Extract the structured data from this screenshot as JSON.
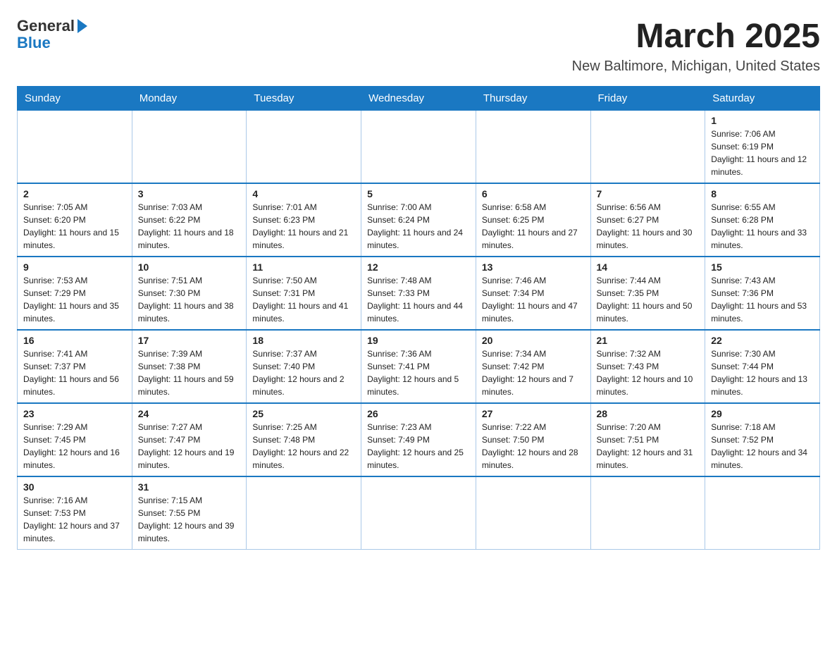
{
  "header": {
    "logo_general": "General",
    "logo_blue": "Blue",
    "title": "March 2025",
    "location": "New Baltimore, Michigan, United States"
  },
  "days_of_week": [
    "Sunday",
    "Monday",
    "Tuesday",
    "Wednesday",
    "Thursday",
    "Friday",
    "Saturday"
  ],
  "weeks": [
    [
      {
        "day": "",
        "sunrise": "",
        "sunset": "",
        "daylight": ""
      },
      {
        "day": "",
        "sunrise": "",
        "sunset": "",
        "daylight": ""
      },
      {
        "day": "",
        "sunrise": "",
        "sunset": "",
        "daylight": ""
      },
      {
        "day": "",
        "sunrise": "",
        "sunset": "",
        "daylight": ""
      },
      {
        "day": "",
        "sunrise": "",
        "sunset": "",
        "daylight": ""
      },
      {
        "day": "",
        "sunrise": "",
        "sunset": "",
        "daylight": ""
      },
      {
        "day": "1",
        "sunrise": "Sunrise: 7:06 AM",
        "sunset": "Sunset: 6:19 PM",
        "daylight": "Daylight: 11 hours and 12 minutes."
      }
    ],
    [
      {
        "day": "2",
        "sunrise": "Sunrise: 7:05 AM",
        "sunset": "Sunset: 6:20 PM",
        "daylight": "Daylight: 11 hours and 15 minutes."
      },
      {
        "day": "3",
        "sunrise": "Sunrise: 7:03 AM",
        "sunset": "Sunset: 6:22 PM",
        "daylight": "Daylight: 11 hours and 18 minutes."
      },
      {
        "day": "4",
        "sunrise": "Sunrise: 7:01 AM",
        "sunset": "Sunset: 6:23 PM",
        "daylight": "Daylight: 11 hours and 21 minutes."
      },
      {
        "day": "5",
        "sunrise": "Sunrise: 7:00 AM",
        "sunset": "Sunset: 6:24 PM",
        "daylight": "Daylight: 11 hours and 24 minutes."
      },
      {
        "day": "6",
        "sunrise": "Sunrise: 6:58 AM",
        "sunset": "Sunset: 6:25 PM",
        "daylight": "Daylight: 11 hours and 27 minutes."
      },
      {
        "day": "7",
        "sunrise": "Sunrise: 6:56 AM",
        "sunset": "Sunset: 6:27 PM",
        "daylight": "Daylight: 11 hours and 30 minutes."
      },
      {
        "day": "8",
        "sunrise": "Sunrise: 6:55 AM",
        "sunset": "Sunset: 6:28 PM",
        "daylight": "Daylight: 11 hours and 33 minutes."
      }
    ],
    [
      {
        "day": "9",
        "sunrise": "Sunrise: 7:53 AM",
        "sunset": "Sunset: 7:29 PM",
        "daylight": "Daylight: 11 hours and 35 minutes."
      },
      {
        "day": "10",
        "sunrise": "Sunrise: 7:51 AM",
        "sunset": "Sunset: 7:30 PM",
        "daylight": "Daylight: 11 hours and 38 minutes."
      },
      {
        "day": "11",
        "sunrise": "Sunrise: 7:50 AM",
        "sunset": "Sunset: 7:31 PM",
        "daylight": "Daylight: 11 hours and 41 minutes."
      },
      {
        "day": "12",
        "sunrise": "Sunrise: 7:48 AM",
        "sunset": "Sunset: 7:33 PM",
        "daylight": "Daylight: 11 hours and 44 minutes."
      },
      {
        "day": "13",
        "sunrise": "Sunrise: 7:46 AM",
        "sunset": "Sunset: 7:34 PM",
        "daylight": "Daylight: 11 hours and 47 minutes."
      },
      {
        "day": "14",
        "sunrise": "Sunrise: 7:44 AM",
        "sunset": "Sunset: 7:35 PM",
        "daylight": "Daylight: 11 hours and 50 minutes."
      },
      {
        "day": "15",
        "sunrise": "Sunrise: 7:43 AM",
        "sunset": "Sunset: 7:36 PM",
        "daylight": "Daylight: 11 hours and 53 minutes."
      }
    ],
    [
      {
        "day": "16",
        "sunrise": "Sunrise: 7:41 AM",
        "sunset": "Sunset: 7:37 PM",
        "daylight": "Daylight: 11 hours and 56 minutes."
      },
      {
        "day": "17",
        "sunrise": "Sunrise: 7:39 AM",
        "sunset": "Sunset: 7:38 PM",
        "daylight": "Daylight: 11 hours and 59 minutes."
      },
      {
        "day": "18",
        "sunrise": "Sunrise: 7:37 AM",
        "sunset": "Sunset: 7:40 PM",
        "daylight": "Daylight: 12 hours and 2 minutes."
      },
      {
        "day": "19",
        "sunrise": "Sunrise: 7:36 AM",
        "sunset": "Sunset: 7:41 PM",
        "daylight": "Daylight: 12 hours and 5 minutes."
      },
      {
        "day": "20",
        "sunrise": "Sunrise: 7:34 AM",
        "sunset": "Sunset: 7:42 PM",
        "daylight": "Daylight: 12 hours and 7 minutes."
      },
      {
        "day": "21",
        "sunrise": "Sunrise: 7:32 AM",
        "sunset": "Sunset: 7:43 PM",
        "daylight": "Daylight: 12 hours and 10 minutes."
      },
      {
        "day": "22",
        "sunrise": "Sunrise: 7:30 AM",
        "sunset": "Sunset: 7:44 PM",
        "daylight": "Daylight: 12 hours and 13 minutes."
      }
    ],
    [
      {
        "day": "23",
        "sunrise": "Sunrise: 7:29 AM",
        "sunset": "Sunset: 7:45 PM",
        "daylight": "Daylight: 12 hours and 16 minutes."
      },
      {
        "day": "24",
        "sunrise": "Sunrise: 7:27 AM",
        "sunset": "Sunset: 7:47 PM",
        "daylight": "Daylight: 12 hours and 19 minutes."
      },
      {
        "day": "25",
        "sunrise": "Sunrise: 7:25 AM",
        "sunset": "Sunset: 7:48 PM",
        "daylight": "Daylight: 12 hours and 22 minutes."
      },
      {
        "day": "26",
        "sunrise": "Sunrise: 7:23 AM",
        "sunset": "Sunset: 7:49 PM",
        "daylight": "Daylight: 12 hours and 25 minutes."
      },
      {
        "day": "27",
        "sunrise": "Sunrise: 7:22 AM",
        "sunset": "Sunset: 7:50 PM",
        "daylight": "Daylight: 12 hours and 28 minutes."
      },
      {
        "day": "28",
        "sunrise": "Sunrise: 7:20 AM",
        "sunset": "Sunset: 7:51 PM",
        "daylight": "Daylight: 12 hours and 31 minutes."
      },
      {
        "day": "29",
        "sunrise": "Sunrise: 7:18 AM",
        "sunset": "Sunset: 7:52 PM",
        "daylight": "Daylight: 12 hours and 34 minutes."
      }
    ],
    [
      {
        "day": "30",
        "sunrise": "Sunrise: 7:16 AM",
        "sunset": "Sunset: 7:53 PM",
        "daylight": "Daylight: 12 hours and 37 minutes."
      },
      {
        "day": "31",
        "sunrise": "Sunrise: 7:15 AM",
        "sunset": "Sunset: 7:55 PM",
        "daylight": "Daylight: 12 hours and 39 minutes."
      },
      {
        "day": "",
        "sunrise": "",
        "sunset": "",
        "daylight": ""
      },
      {
        "day": "",
        "sunrise": "",
        "sunset": "",
        "daylight": ""
      },
      {
        "day": "",
        "sunrise": "",
        "sunset": "",
        "daylight": ""
      },
      {
        "day": "",
        "sunrise": "",
        "sunset": "",
        "daylight": ""
      },
      {
        "day": "",
        "sunrise": "",
        "sunset": "",
        "daylight": ""
      }
    ]
  ]
}
